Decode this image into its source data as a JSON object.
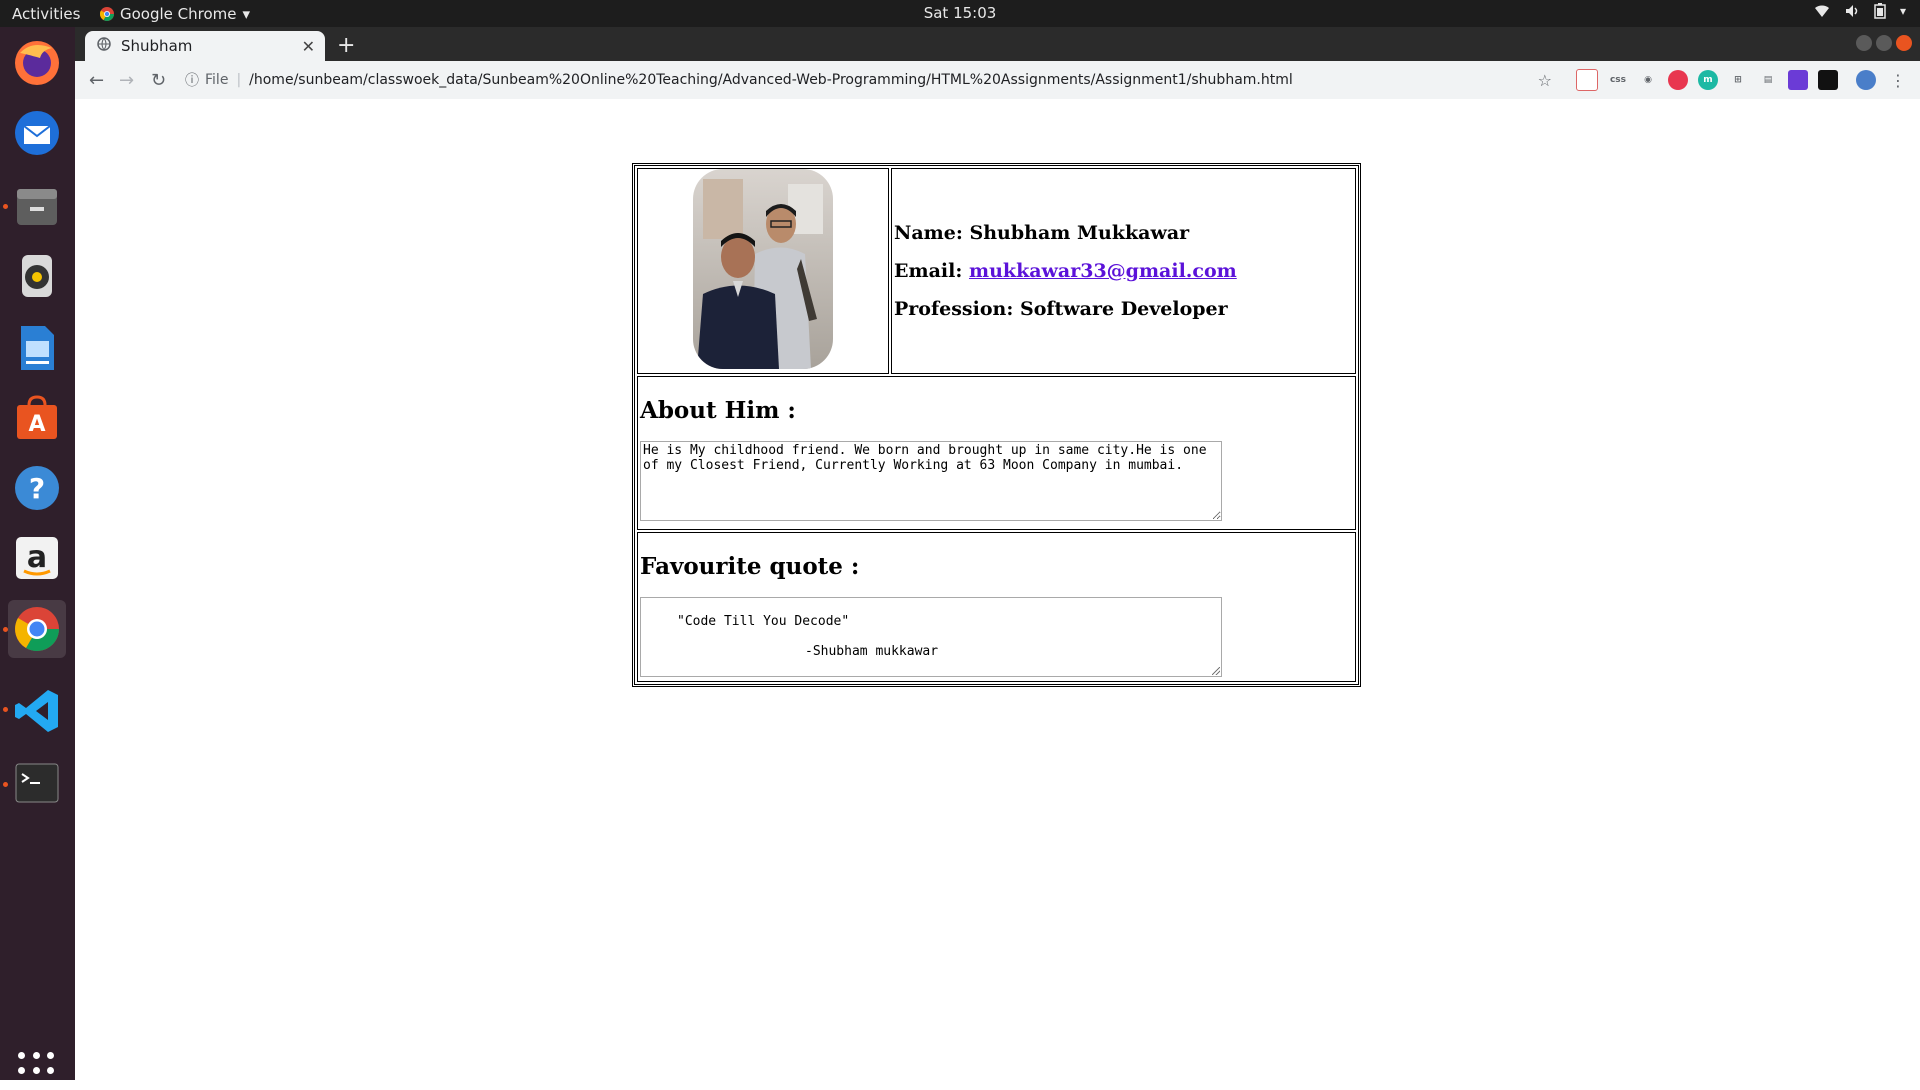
{
  "topbar": {
    "activities": "Activities",
    "app_name": "Google Chrome",
    "clock": "Sat 15:03"
  },
  "browser": {
    "tab_title": "Shubham",
    "new_tab": "+",
    "file_label": "File",
    "url": "/home/sunbeam/classwoek_data/Sunbeam%20Online%20Teaching/Advanced-Web-Programming/HTML%20Assignments/Assignment1/shubham.html",
    "extensions": [
      "css"
    ]
  },
  "dock": {
    "apps": [
      "firefox-icon",
      "thunderbird-icon",
      "files-icon",
      "rhythmbox-icon",
      "writer-icon",
      "software-center-icon",
      "help-icon",
      "amazon-icon",
      "chrome-icon",
      "vscode-icon",
      "terminal-icon"
    ]
  },
  "profile": {
    "name_label": "Name:",
    "name": "Shubham Mukkawar",
    "email_label": "Email:",
    "email": "mukkawar33@gmail.com",
    "profession_label": "Profession:",
    "profession": "Software Developer",
    "about_heading": "About Him :",
    "about_text": "He is My childhood friend. We born and brought up in same city.He is one of my Closest Friend, Currently Working at 63 Moon Company in mumbai.",
    "quote_heading": "Favourite quote :",
    "quote_line1": "\"Code Till You Decode\"",
    "quote_line2": "-Shubham mukkawar"
  },
  "colors": {
    "link": "#5b12d9",
    "dock_bg": "#2f1f2b",
    "topbar_bg": "#1d1d1d",
    "accent": "#e95420"
  }
}
